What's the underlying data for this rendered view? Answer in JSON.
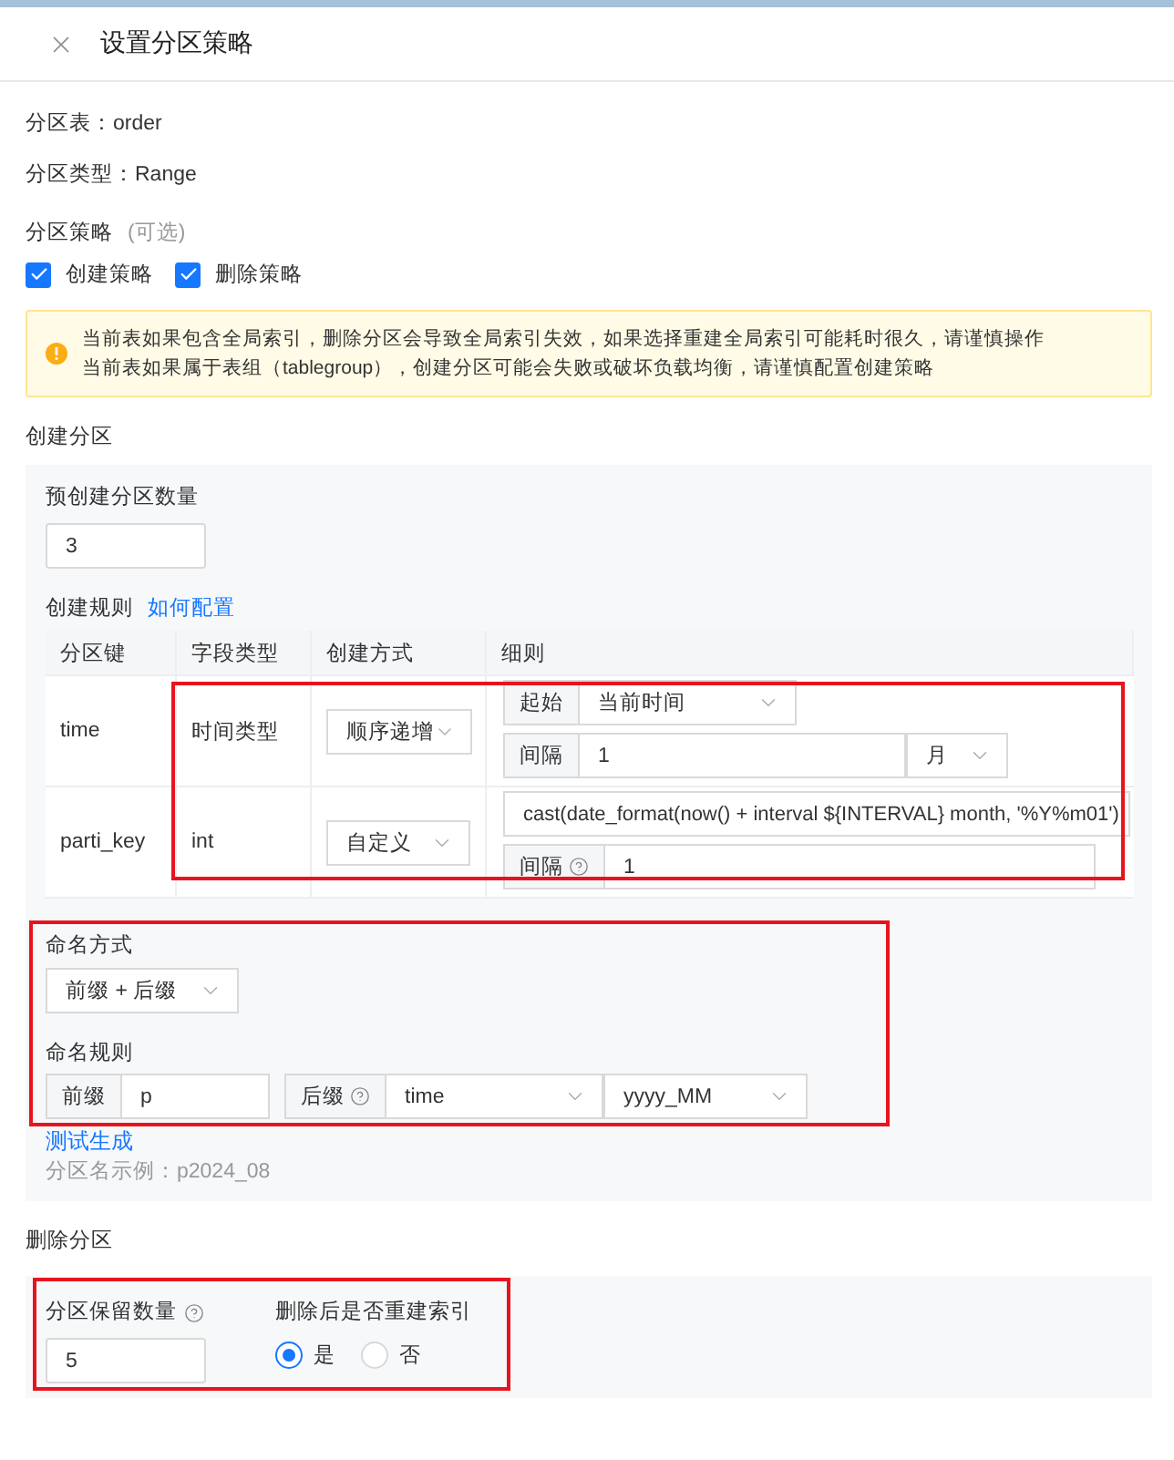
{
  "dialog": {
    "title": "设置分区策略"
  },
  "info": [
    "分区表：order",
    "分区类型：Range"
  ],
  "strategy": {
    "label": "分区策略",
    "hint": "(可选)",
    "options": [
      {
        "label": "创建策略",
        "checked": true
      },
      {
        "label": "删除策略",
        "checked": true
      }
    ]
  },
  "alert": {
    "lines": [
      "当前表如果包含全局索引，删除分区会导致全局索引失效，如果选择重建全局索引可能耗时很久，请谨慎操作",
      "当前表如果属于表组（tablegroup），创建分区可能会失败或破坏负载均衡，请谨慎配置创建策略"
    ]
  },
  "create": {
    "title": "创建分区",
    "count_label": "预创建分区数量",
    "count": "3",
    "rules_label": "创建规则",
    "rules_link": "如何配置",
    "columns": [
      "分区键",
      "字段类型",
      "创建方式",
      "细则"
    ],
    "rows": [
      {
        "key": "time",
        "type": "时间类型",
        "method": "顺序递增",
        "details": [
          {
            "addon": "起始",
            "help": false,
            "value": "当前时间",
            "dropdown": true
          },
          {
            "addon": "间隔",
            "help": false,
            "value": "1",
            "dropdown": false,
            "unit": "月"
          }
        ]
      },
      {
        "key": "parti_key",
        "type": "int",
        "method": "自定义",
        "details": [
          {
            "value": "cast(date_format(now() + interval ${INTERVAL} month, '%Y%m01')",
            "dropdown": false
          },
          {
            "addon": "间隔",
            "help": true,
            "value": "1",
            "dropdown": false
          }
        ]
      }
    ],
    "naming": {
      "mode_label": "命名方式",
      "mode": "前缀 + 后缀",
      "rule_label": "命名规则",
      "prefix_addon": "前缀",
      "prefix": "p",
      "suffix_addon": "后缀",
      "suffix_field": "time",
      "suffix_format": "yyyy_MM",
      "test_link": "测试生成",
      "example": "分区名示例：p2024_08"
    }
  },
  "delete": {
    "title": "删除分区",
    "keep_label": "分区保留数量",
    "keep": "5",
    "rebuild_label": "删除后是否重建索引",
    "options": [
      {
        "label": "是",
        "selected": true
      },
      {
        "label": "否",
        "selected": false
      }
    ]
  }
}
